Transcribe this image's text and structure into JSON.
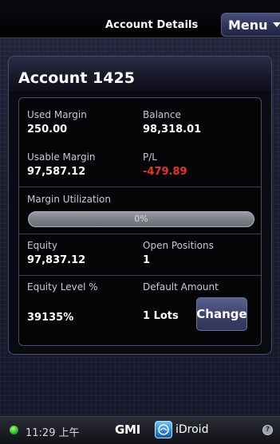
{
  "header": {
    "title": "Account Details",
    "menu_label": "Menu"
  },
  "account": {
    "title": "Account 1425",
    "used_margin_label": "Used Margin",
    "used_margin_value": "250.00",
    "balance_label": "Balance",
    "balance_value": "98,318.01",
    "usable_margin_label": "Usable Margin",
    "usable_margin_value": "97,587.12",
    "pl_label": "P/L",
    "pl_value": "-479.89",
    "margin_utilization_label": "Margin Utilization",
    "margin_utilization_text": "0%",
    "margin_utilization_fraction": 0.0,
    "equity_label": "Equity",
    "equity_value": "97,837.12",
    "open_positions_label": "Open Positions",
    "open_positions_value": "1",
    "equity_level_label": "Equity Level %",
    "equity_level_value": "39135%",
    "default_amount_label": "Default Amount",
    "default_amount_value": "1 Lots",
    "change_label": "Change"
  },
  "status_bar": {
    "time": "11:29 上午",
    "brand": "GMI",
    "app": "iDroid",
    "signal_icon": "green-status-dot",
    "info_icon": "info-icon"
  },
  "colors": {
    "negative": "#e8322c",
    "accent_button": "#3d416b"
  }
}
